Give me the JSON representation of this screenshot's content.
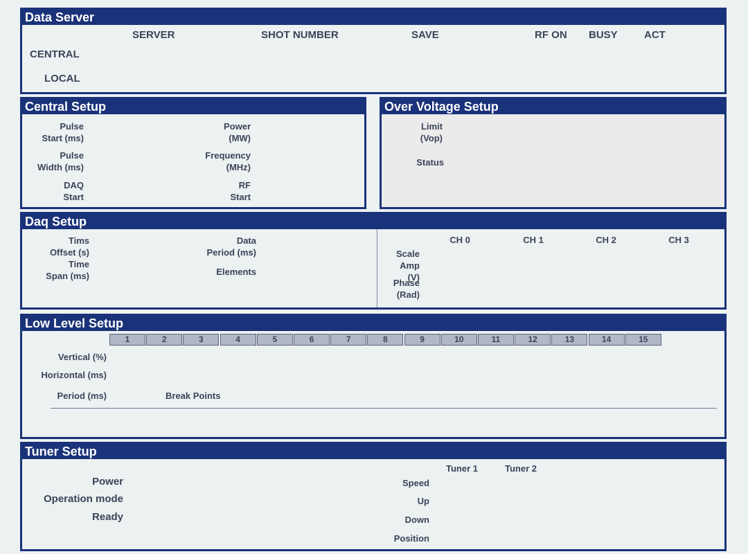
{
  "data_server": {
    "title": "Data Server",
    "columns": [
      "SERVER",
      "SHOT NUMBER",
      "SAVE",
      "RF ON",
      "BUSY",
      "ACT"
    ],
    "rows": [
      "CENTRAL",
      "LOCAL"
    ]
  },
  "central_setup": {
    "title": "Central Setup",
    "pulse_start": [
      "Pulse",
      "Start (ms)"
    ],
    "power": [
      "Power",
      "(MW)"
    ],
    "pulse_width": [
      "Pulse",
      "Width (ms)"
    ],
    "frequency": [
      "Frequency",
      "(MHz)"
    ],
    "daq_start": [
      "DAQ",
      "Start"
    ],
    "rf_start": [
      "RF",
      "Start"
    ]
  },
  "over_voltage_setup": {
    "title": "Over Voltage Setup",
    "limit": [
      "Limit",
      "(Vop)"
    ],
    "status": "Status"
  },
  "daq_setup": {
    "title": "Daq Setup",
    "tims_offset": [
      "Tims",
      "Offset (s)"
    ],
    "time_span": [
      "Time",
      "Span (ms)"
    ],
    "data_period": [
      "Data",
      "Period (ms)"
    ],
    "elements": "Elements",
    "channels": [
      "CH 0",
      "CH 1",
      "CH 2",
      "CH 3"
    ],
    "scale_amp": [
      "Scale",
      "Amp",
      "(V)"
    ],
    "phase": [
      "Phase",
      "(Rad)"
    ]
  },
  "low_level_setup": {
    "title": "Low Level Setup",
    "break_point_indices": [
      "1",
      "2",
      "3",
      "4",
      "5",
      "6",
      "7",
      "8",
      "9",
      "10",
      "11",
      "12",
      "13",
      "14",
      "15"
    ],
    "vertical": "Vertical (%)",
    "horizontal": "Horizontal (ms)",
    "period": "Period (ms)",
    "break_points": "Break Points"
  },
  "tuner_setup": {
    "title": "Tuner Setup",
    "power": "Power",
    "operation_mode": "Operation mode",
    "ready": "Ready",
    "tuners": [
      "Tuner 1",
      "Tuner 2"
    ],
    "speed": "Speed",
    "up": "Up",
    "down": "Down",
    "position": "Position"
  }
}
